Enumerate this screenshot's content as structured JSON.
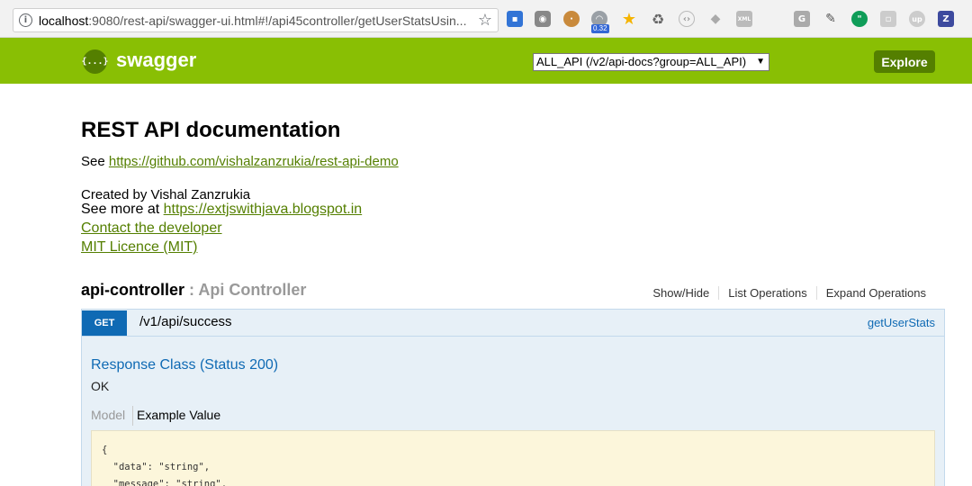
{
  "browser": {
    "url_host": "localhost",
    "url_rest": ":9080/rest-api/swagger-ui.html#!/api45controller/getUserStatsUsin...",
    "extension_badge": "0.32",
    "extensions": [
      "delicious-icon",
      "camera-icon",
      "cookie-icon",
      "speedometer-icon",
      "star-icon",
      "recycle-icon",
      "code-icon",
      "dropbox-icon",
      "xml-icon",
      "g-icon",
      "eyedropper-icon",
      "hangouts-icon",
      "puzzle-icon",
      "up-icon",
      "z-icon"
    ]
  },
  "header": {
    "logo_glyph": "{...}",
    "logo_text": "swagger",
    "api_select": "ALL_API (/v2/api-docs?group=ALL_API)",
    "explore_label": "Explore",
    "accent": "#89bf04"
  },
  "info": {
    "title": "REST API documentation",
    "see_prefix": "See ",
    "repo_link": "https://github.com/vishalzanzrukia/rest-api-demo",
    "created_by": "Created by Vishal Zanzrukia",
    "see_more_prefix": "See more at ",
    "blog_link": "https://extjswithjava.blogspot.in",
    "contact_link": "Contact the developer",
    "license_link": "MIT Licence (MIT)"
  },
  "resource": {
    "name": "api-controller",
    "separator": " : ",
    "description": "Api Controller",
    "actions": [
      "Show/Hide",
      "List Operations",
      "Expand Operations"
    ]
  },
  "operation": {
    "method": "GET",
    "path": "/v1/api/success",
    "nickname": "getUserStats",
    "response_title": "Response Class (Status 200)",
    "response_text": "OK",
    "tab_model": "Model",
    "tab_example": "Example Value",
    "code_lines": [
      "{",
      "  \"data\": \"string\",",
      "  \"message\": \"string\","
    ]
  }
}
